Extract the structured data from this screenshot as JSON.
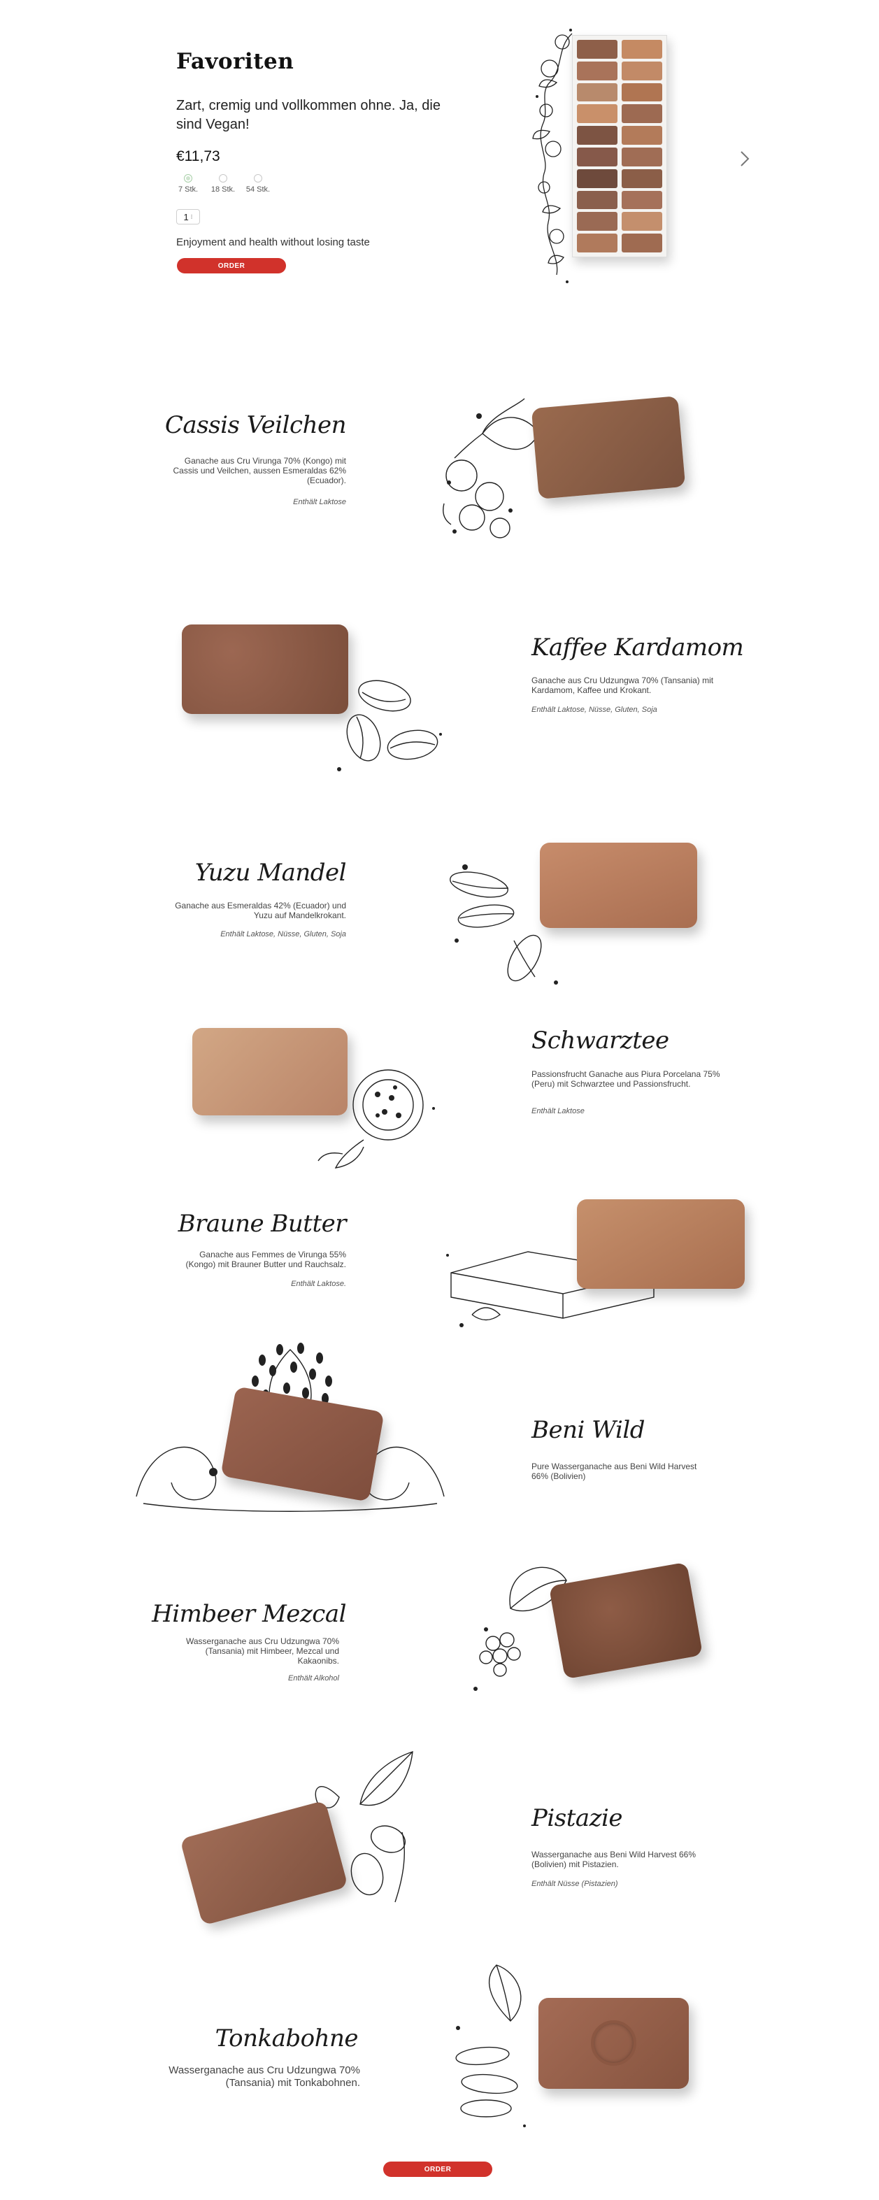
{
  "hero": {
    "title": "Favoriten",
    "subtitle": "Zart, cremig und vollkommen ohne. Ja, die sind Vegan!",
    "price": "€11,73",
    "sizes": [
      {
        "label": "7 Stk.",
        "selected": true
      },
      {
        "label": "18 Stk.",
        "selected": false
      },
      {
        "label": "54 Stk.",
        "selected": false
      }
    ],
    "quantity": "1",
    "tagline": "Enjoyment and health without losing taste",
    "order_label": "ORDER"
  },
  "pralines": [
    {
      "name": "Cassis Veilchen",
      "description": "Ganache aus Cru Virunga 70% (Kongo) mit Cassis und Veilchen, aussen Esmeraldas 62% (Ecuador).",
      "note": "Enthält Laktose"
    },
    {
      "name": "Kaffee Kardamom",
      "description": "Ganache aus Cru Udzungwa 70% (Tansania) mit Kardamom, Kaffee und Krokant.",
      "note": "Enthält Laktose, Nüsse, Gluten, Soja"
    },
    {
      "name": "Yuzu Mandel",
      "description": "Ganache aus Esmeraldas 42% (Ecuador) und Yuzu auf Mandelkrokant.",
      "note": "Enthält Laktose, Nüsse, Gluten, Soja"
    },
    {
      "name": "Schwarztee",
      "description": "Passionsfrucht Ganache aus Piura Porcelana 75% (Peru) mit Schwarztee und Passionsfrucht.",
      "note": "Enthält Laktose"
    },
    {
      "name": "Braune Butter",
      "description": "Ganache aus Femmes de Virunga 55% (Kongo) mit Brauner Butter und Rauchsalz.",
      "note": "Enthält Laktose."
    },
    {
      "name": "Beni Wild",
      "description": "Pure Wasserganache aus Beni Wild Harvest 66% (Bolivien)",
      "note": ""
    },
    {
      "name": "Himbeer Mezcal",
      "description": "Wasserganache aus Cru Udzungwa 70% (Tansania) mit Himbeer, Mezcal und Kakaonibs.",
      "note": "Enthält Alkohol"
    },
    {
      "name": "Pistazie",
      "description": "Wasserganache aus Beni Wild Harvest 66% (Bolivien) mit Pistazien.",
      "note": "Enthält Nüsse (Pistazien)"
    },
    {
      "name": "Tonkabohne",
      "description": "Wasserganache aus Cru Udzungwa 70% (Tansania) mit Tonkabohnen.",
      "note": ""
    }
  ],
  "colors": {
    "accent": "#d1322b",
    "chocolate_milk": "#b07a5c",
    "chocolate_dark": "#7b4a35"
  },
  "icons": {
    "next": "chevron-right-icon"
  },
  "footer": {
    "order_label": "ORDER"
  }
}
